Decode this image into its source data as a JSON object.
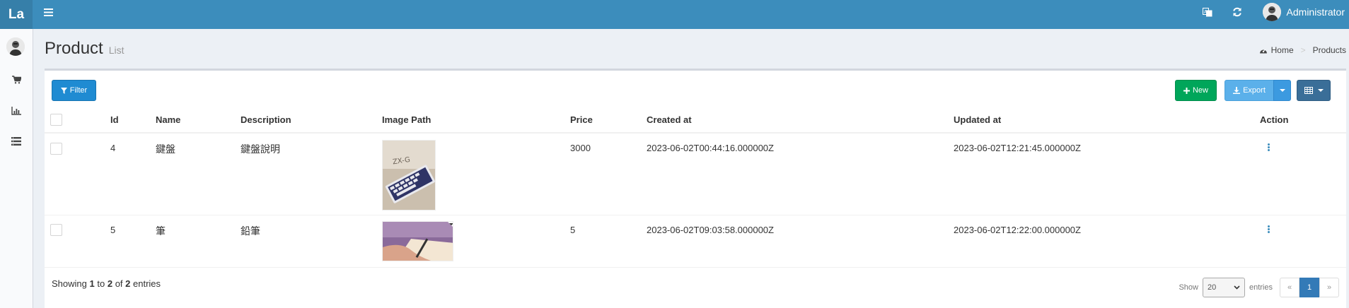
{
  "header": {
    "logo": "La",
    "user_name": "Administrator"
  },
  "page": {
    "title": "Product",
    "subtitle": "List"
  },
  "breadcrumb": {
    "home": "Home",
    "current": "Products"
  },
  "toolbar": {
    "filter_label": "Filter",
    "new_label": "New",
    "export_label": "Export"
  },
  "table": {
    "columns": [
      "Id",
      "Name",
      "Description",
      "Image Path",
      "Price",
      "Created at",
      "Updated at",
      "Action"
    ],
    "rows": [
      {
        "id": "4",
        "name": "鍵盤",
        "description": "鍵盤說明",
        "price": "3000",
        "created_at": "2023-06-02T00:44:16.000000Z",
        "updated_at": "2023-06-02T12:21:45.000000Z"
      },
      {
        "id": "5",
        "name": "筆",
        "description": "鉛筆",
        "price": "5",
        "created_at": "2023-06-02T09:03:58.000000Z",
        "updated_at": "2023-06-02T12:22:00.000000Z"
      }
    ]
  },
  "footer": {
    "showing_prefix": "Showing",
    "from": "1",
    "to_word": "to",
    "to": "2",
    "of_word": "of",
    "total": "2",
    "entries_word": "entries",
    "show_label": "Show",
    "per_page": "20",
    "entries_label": "entries",
    "prev": "«",
    "page": "1",
    "next": "»"
  },
  "colors": {
    "header": "#3c8dbc",
    "filter": "#1f8bd2",
    "new": "#00a65a",
    "export": "#5bb0ea",
    "columns": "#3a6e98"
  },
  "icons": {
    "menu": "hamburger-icon",
    "translate": "translate-icon",
    "refresh": "refresh-icon",
    "cart": "cart-icon",
    "chart": "bar-chart-icon",
    "list": "list-icon",
    "filter": "filter-icon",
    "plus": "plus-icon",
    "download": "download-icon",
    "table": "table-icon",
    "home": "dashboard-icon"
  }
}
